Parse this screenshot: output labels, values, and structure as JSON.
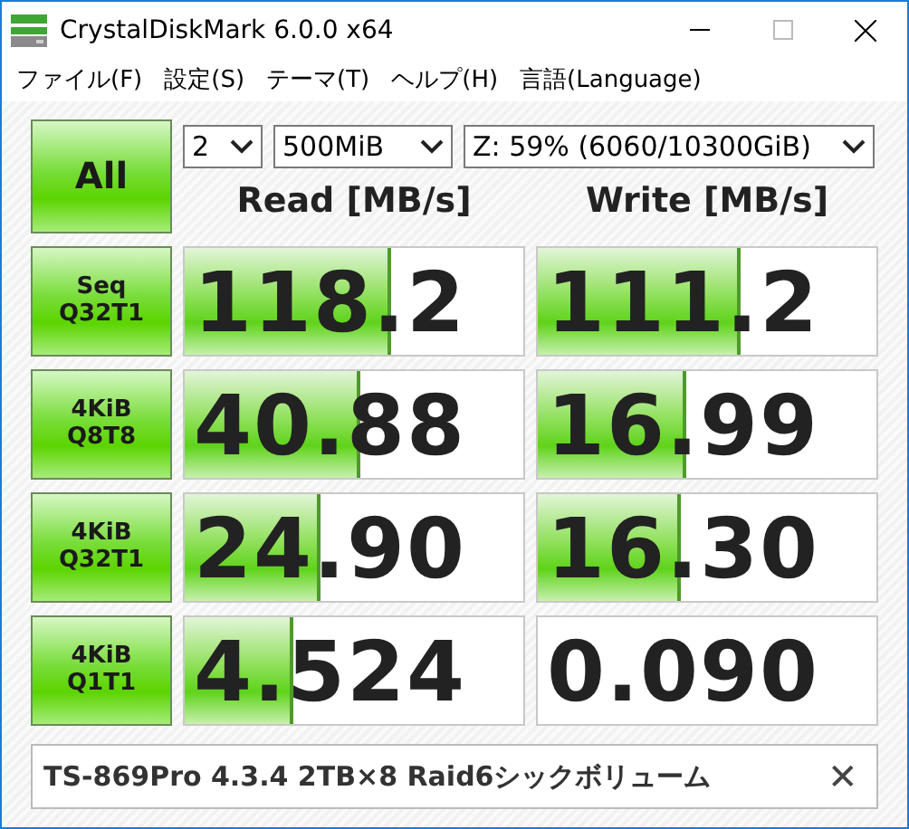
{
  "window": {
    "title": "CrystalDiskMark 6.0.0 x64"
  },
  "menu": [
    "ファイル(F)",
    "設定(S)",
    "テーマ(T)",
    "ヘルプ(H)",
    "言語(Language)"
  ],
  "all_button": "All",
  "selects": [
    {
      "value": "2"
    },
    {
      "value": "500MiB"
    },
    {
      "value": "Z: 59% (6060/10300GiB)"
    }
  ],
  "headers": {
    "read": "Read [MB/s]",
    "write": "Write [MB/s]"
  },
  "rows": [
    {
      "label_line_1": "Seq",
      "label_line_2": "Q32T1",
      "read": {
        "value": "118.2",
        "level": 0.61
      },
      "write": {
        "value": "111.2",
        "level": 0.6
      }
    },
    {
      "label_line_1": "4KiB",
      "label_line_2": "Q8T8",
      "read": {
        "value": "40.88",
        "level": 0.52
      },
      "write": {
        "value": "16.99",
        "level": 0.44
      }
    },
    {
      "label_line_1": "4KiB",
      "label_line_2": "Q32T1",
      "read": {
        "value": "24.90",
        "level": 0.4
      },
      "write": {
        "value": "16.30",
        "level": 0.42
      }
    },
    {
      "label_line_1": "4KiB",
      "label_line_2": "Q1T1",
      "read": {
        "value": "4.524",
        "level": 0.32
      },
      "write": {
        "value": "0.090"
      }
    }
  ],
  "comment": {
    "value": "TS-869Pro 4.3.4 2TB×8 Raid6シックボリューム",
    "clear": "✕"
  }
}
